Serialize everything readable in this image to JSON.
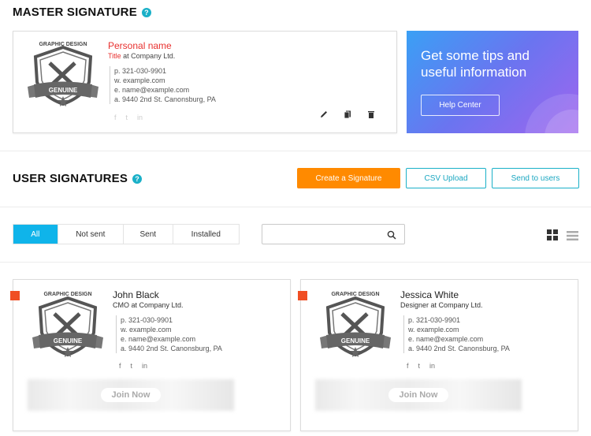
{
  "master": {
    "title": "MASTER SIGNATURE",
    "help": "?",
    "logo": {
      "top": "GRAPHIC DESIGN",
      "banner": "GENUINE"
    },
    "name": "Personal name",
    "title_word": "Title",
    "company": " at Company Ltd.",
    "phone": "p. 321-030-9901",
    "website": "w. example.com",
    "email": "e. name@example.com",
    "address": "a. 9440 2nd St. Canonsburg, PA",
    "social": [
      "f",
      "t",
      "in"
    ]
  },
  "tips": {
    "title": "Get some tips and useful information",
    "button": "Help Center"
  },
  "users_section": {
    "title": "USER SIGNATURES",
    "help": "?",
    "create_button": "Create a Signature",
    "csv_button": "CSV Upload",
    "send_button": "Send to users"
  },
  "filters": {
    "tabs": [
      "All",
      "Not sent",
      "Sent",
      "Installed"
    ],
    "active": "All",
    "search_placeholder": ""
  },
  "signatures": [
    {
      "logo": {
        "top": "GRAPHIC DESIGN",
        "banner": "GENUINE"
      },
      "name": "John Black",
      "role": "CMO at Company Ltd.",
      "phone": "p. 321-030-9901",
      "website": "w. example.com",
      "email": "e. name@example.com",
      "address": "a. 9440 2nd St. Canonsburg, PA",
      "social": [
        "f",
        "t",
        "in"
      ],
      "banner_text": "Join Now"
    },
    {
      "logo": {
        "top": "GRAPHIC DESIGN",
        "banner": "GENUINE"
      },
      "name": "Jessica White",
      "role": "Designer at Company Ltd.",
      "phone": "p. 321-030-9901",
      "website": "w. example.com",
      "email": "e. name@example.com",
      "address": "a. 9440 2nd St. Canonsburg, PA",
      "social": [
        "f",
        "t",
        "in"
      ],
      "banner_text": "Join Now"
    }
  ],
  "colors": {
    "accent": "#1ab0c8",
    "primary_action": "#ff8a00",
    "active_tab": "#0fb4ea",
    "flag": "#f04e23",
    "name_red": "#e8312f"
  }
}
